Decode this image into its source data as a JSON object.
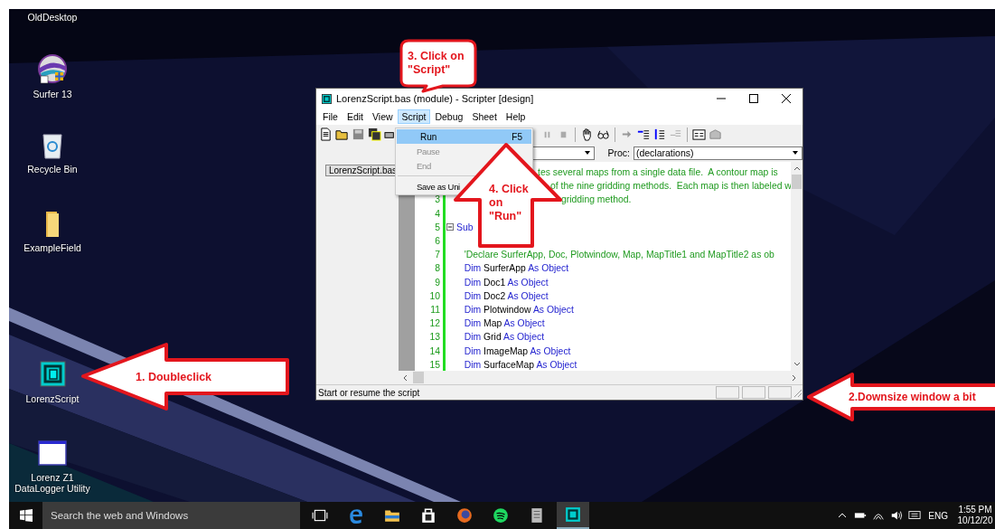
{
  "desktop_icons": [
    {
      "label": "OldDesktop"
    },
    {
      "label": "Surfer 13",
      "kind": "surfer"
    },
    {
      "label": "Recycle Bin",
      "kind": "recycle"
    },
    {
      "label": "ExampleField",
      "kind": "folder"
    },
    {
      "label": "LorenzScript",
      "kind": "script"
    },
    {
      "label": "Lorenz Z1 DataLogger Utility",
      "kind": "app"
    }
  ],
  "window": {
    "title": "LorenzScript.bas (module) - Scripter [design]",
    "menu": [
      {
        "label": "File",
        "selected": false
      },
      {
        "label": "Edit",
        "selected": false
      },
      {
        "label": "View",
        "selected": false
      },
      {
        "label": "Script",
        "selected": true
      },
      {
        "label": "Debug",
        "selected": false
      },
      {
        "label": "Sheet",
        "selected": false
      },
      {
        "label": "Help",
        "selected": false
      }
    ],
    "script_menu": [
      {
        "label": "Run",
        "shortcut": "F5",
        "disabled": false,
        "selected": true
      },
      {
        "label": "Pause",
        "disabled": true,
        "selected": false
      },
      {
        "label": "End",
        "disabled": true,
        "selected": false
      },
      {
        "label": "Save as Uni",
        "disabled": false,
        "selected": false
      }
    ],
    "proc_label": "Proc:",
    "proc_value": "(declarations)",
    "module_tab": "LorenzScript.bas",
    "code_lines": [
      {
        "kind": "line",
        "segments": [
          {
            "text": "tes several maps from a single data file.  A contour map is",
            "kind": "comment"
          }
        ]
      },
      {
        "kind": "line",
        "segments": [
          {
            "text": "of the nine gridding methods.  Each map is then labeled w",
            "kind": "comment"
          }
        ]
      },
      {
        "number": "3",
        "kind": "line",
        "segments": [
          {
            "text": "gridding method.",
            "kind": "comment"
          }
        ]
      },
      {
        "number": "4",
        "kind": "line"
      },
      {
        "number": "5",
        "kind": "fold",
        "segments": [
          {
            "text": "Sub",
            "kind": "keyword"
          }
        ]
      },
      {
        "number": "6",
        "kind": "line"
      },
      {
        "number": "7",
        "kind": "line",
        "segments": [
          {
            "text": "   'Declare SurferApp, Doc, Plotwindow, Map, MapTitle1 and MapTitle2 as ob",
            "kind": "comment"
          }
        ]
      },
      {
        "number": "8",
        "kind": "line",
        "segments": [
          {
            "text": "   Dim",
            "kind": "keyword"
          },
          {
            "text": " SurferApp ",
            "kind": "plain"
          },
          {
            "text": "As Object",
            "kind": "keyword"
          }
        ]
      },
      {
        "number": "9",
        "kind": "line",
        "segments": [
          {
            "text": "   Dim",
            "kind": "keyword"
          },
          {
            "text": " Doc1 ",
            "kind": "plain"
          },
          {
            "text": "As Object",
            "kind": "keyword"
          }
        ]
      },
      {
        "number": "10",
        "kind": "line",
        "segments": [
          {
            "text": "   Dim",
            "kind": "keyword"
          },
          {
            "text": " Doc2 ",
            "kind": "plain"
          },
          {
            "text": "As Object",
            "kind": "keyword"
          }
        ]
      },
      {
        "number": "11",
        "kind": "line",
        "segments": [
          {
            "text": "   Dim",
            "kind": "keyword"
          },
          {
            "text": " Plotwindow ",
            "kind": "plain"
          },
          {
            "text": "As Object",
            "kind": "keyword"
          }
        ]
      },
      {
        "number": "12",
        "kind": "line",
        "segments": [
          {
            "text": "   Dim",
            "kind": "keyword"
          },
          {
            "text": " Map ",
            "kind": "plain"
          },
          {
            "text": "As Object",
            "kind": "keyword"
          }
        ]
      },
      {
        "number": "13",
        "kind": "line",
        "segments": [
          {
            "text": "   Dim",
            "kind": "keyword"
          },
          {
            "text": " Grid ",
            "kind": "plain"
          },
          {
            "text": "As Object",
            "kind": "keyword"
          }
        ]
      },
      {
        "number": "14",
        "kind": "line",
        "segments": [
          {
            "text": "   Dim",
            "kind": "keyword"
          },
          {
            "text": " ImageMap ",
            "kind": "plain"
          },
          {
            "text": "As Object",
            "kind": "keyword"
          }
        ]
      },
      {
        "number": "15",
        "kind": "line",
        "segments": [
          {
            "text": "   Dim",
            "kind": "keyword"
          },
          {
            "text": " SurfaceMap ",
            "kind": "plain"
          },
          {
            "text": "As Object",
            "kind": "keyword"
          }
        ]
      }
    ],
    "status": "Start or resume the script"
  },
  "callouts": [
    {
      "kind": "arrow_left",
      "text": "1. Doubleclick"
    },
    {
      "kind": "arrow_left_edge",
      "text": "2.Downsize window a bit"
    },
    {
      "kind": "speech",
      "text": "3. Click on \"Script\""
    },
    {
      "kind": "arrow_up",
      "text": "4. Click on \"Run\""
    }
  ],
  "taskbar": {
    "search_placeholder": "Search the web and Windows",
    "apps": [
      {
        "kind": "task_view",
        "selected": false
      },
      {
        "kind": "edge",
        "selected": false
      },
      {
        "kind": "explorer",
        "selected": false
      },
      {
        "kind": "store",
        "selected": false
      },
      {
        "kind": "firefox",
        "selected": false
      },
      {
        "kind": "spotify",
        "selected": false
      },
      {
        "kind": "document",
        "selected": false
      },
      {
        "kind": "script",
        "selected": true
      }
    ],
    "language": "ENG",
    "time": "1:55 PM",
    "date": "10/12/20"
  }
}
